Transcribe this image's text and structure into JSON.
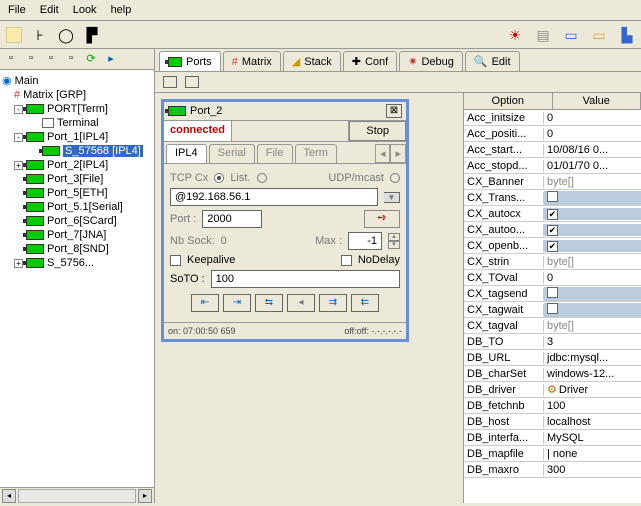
{
  "menu": {
    "items": [
      "File",
      "Edit",
      "Look",
      "help"
    ]
  },
  "tree": {
    "root": "Main",
    "l1a": "Matrix [GRP]",
    "l1b": "PORT[Term]",
    "l1b_c": "Terminal",
    "l1c": "Port_1[IPL4]",
    "l1c_c": "S_57568 [IPL4]",
    "items": [
      "Port_2[IPL4]",
      "Port_3[File]",
      "Port_5[ETH]",
      "Port_5.1[Serial]",
      "Port_6[SCard]",
      "Port_7[JNA]",
      "Port_8[SND]",
      "S_5756..."
    ]
  },
  "tabs": [
    "Ports",
    "Matrix",
    "Stack",
    "Conf",
    "Debug",
    "Edit"
  ],
  "portwin": {
    "title": "Port_2",
    "status": "connected",
    "stop": "Stop",
    "subtabs": [
      "IPL4",
      "Serial",
      "File",
      "Term"
    ],
    "row_tcp": "TCP Cx",
    "row_list": "List.",
    "row_udp": "UDP/mcast",
    "ip": "@192.168.56.1",
    "port_l": "Port :",
    "port_v": "2000",
    "nb_l": "Nb Sock:",
    "nb_v": "0",
    "max_l": "Max :",
    "max_v": "-1",
    "keep": "Keepalive",
    "nodelay": "NoDelay",
    "soto_l": "SoTO :",
    "soto_v": "100",
    "foot_on": "on: 07:00:50 659",
    "foot_off": "off:off: -.-.-.-.-.-"
  },
  "props": {
    "head_opt": "Option",
    "head_val": "Value",
    "rows": [
      {
        "k": "Acc_initsize",
        "v": "0"
      },
      {
        "k": "Acc_positi...",
        "v": "0"
      },
      {
        "k": "Acc_start...",
        "v": "10/08/16 0..."
      },
      {
        "k": "Acc_stopd...",
        "v": "01/01/70 0..."
      },
      {
        "k": "CX_Banner",
        "v": "byte[]"
      },
      {
        "k": "CX_Trans...",
        "v": ""
      },
      {
        "k": "CX_autocx",
        "v": "✔"
      },
      {
        "k": "CX_autoo...",
        "v": "✔"
      },
      {
        "k": "CX_openb...",
        "v": "✔"
      },
      {
        "k": "CX_strin",
        "v": "byte[]"
      },
      {
        "k": "CX_TOval",
        "v": "0"
      },
      {
        "k": "CX_tagsend",
        "v": ""
      },
      {
        "k": "CX_tagwait",
        "v": ""
      },
      {
        "k": "CX_tagval",
        "v": "byte[]"
      },
      {
        "k": "DB_TO",
        "v": "3"
      },
      {
        "k": "DB_URL",
        "v": "jdbc:mysql..."
      },
      {
        "k": "DB_charSet",
        "v": "windows-12..."
      },
      {
        "k": "DB_driver",
        "v": "Driver"
      },
      {
        "k": "DB_fetchnb",
        "v": "100"
      },
      {
        "k": "DB_host",
        "v": "localhost"
      },
      {
        "k": "DB_interfa...",
        "v": "MySQL"
      },
      {
        "k": "DB_mapfile",
        "v": "| none"
      },
      {
        "k": "DB_maxro",
        "v": "300"
      }
    ]
  }
}
